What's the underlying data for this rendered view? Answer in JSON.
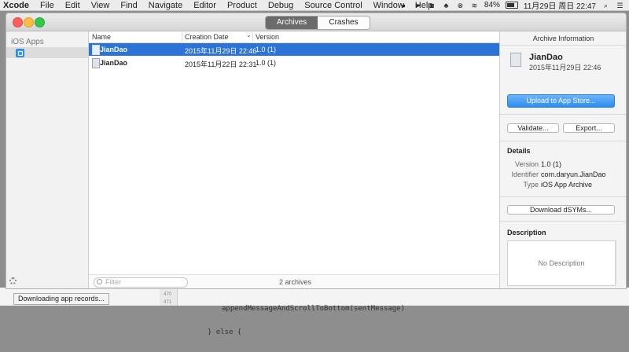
{
  "menubar": {
    "app": "Xcode",
    "items": [
      "File",
      "Edit",
      "View",
      "Find",
      "Navigate",
      "Editor",
      "Product",
      "Debug",
      "Source Control",
      "Window",
      "Help"
    ],
    "battery": "84%",
    "datetime": "11月29日 周日  22:47"
  },
  "window": {
    "segments": [
      "Archives",
      "Crashes"
    ],
    "active_segment": "Archives"
  },
  "sidebar": {
    "header": "iOS Apps"
  },
  "list": {
    "columns": [
      "Name",
      "Creation Date",
      "Version"
    ],
    "rows": [
      {
        "name": "JianDao",
        "date": "2015年11月29日 22:46",
        "version": "1.0 (1)",
        "selected": true
      },
      {
        "name": "JianDao",
        "date": "2015年11月22日 22:31",
        "version": "1.0 (1)",
        "selected": false
      }
    ],
    "filter_placeholder": "Filter",
    "count": "2 archives"
  },
  "inspector": {
    "title": "Archive Information",
    "archive_name": "JianDao",
    "archive_date": "2015年11月29日 22:46",
    "upload_button": "Upload to App Store...",
    "validate_button": "Validate...",
    "export_button": "Export...",
    "details_header": "Details",
    "details": [
      {
        "key": "Version",
        "value": "1.0 (1)"
      },
      {
        "key": "Identifier",
        "value": "com.daryun.JianDao"
      },
      {
        "key": "Type",
        "value": "iOS App Archive"
      }
    ],
    "dsym_button": "Download dSYMs...",
    "description_header": "Description",
    "description_placeholder": "No Description"
  },
  "background": {
    "status": "Downloading app records...",
    "code_line_1": "appendMessageAndScrollToBottom(sentMessage)",
    "code_line_2": "} else {",
    "line_numbers": [
      "470",
      "471"
    ]
  },
  "colors": {
    "selection": "#2b73d6",
    "primary_button": "#2d8df0"
  }
}
